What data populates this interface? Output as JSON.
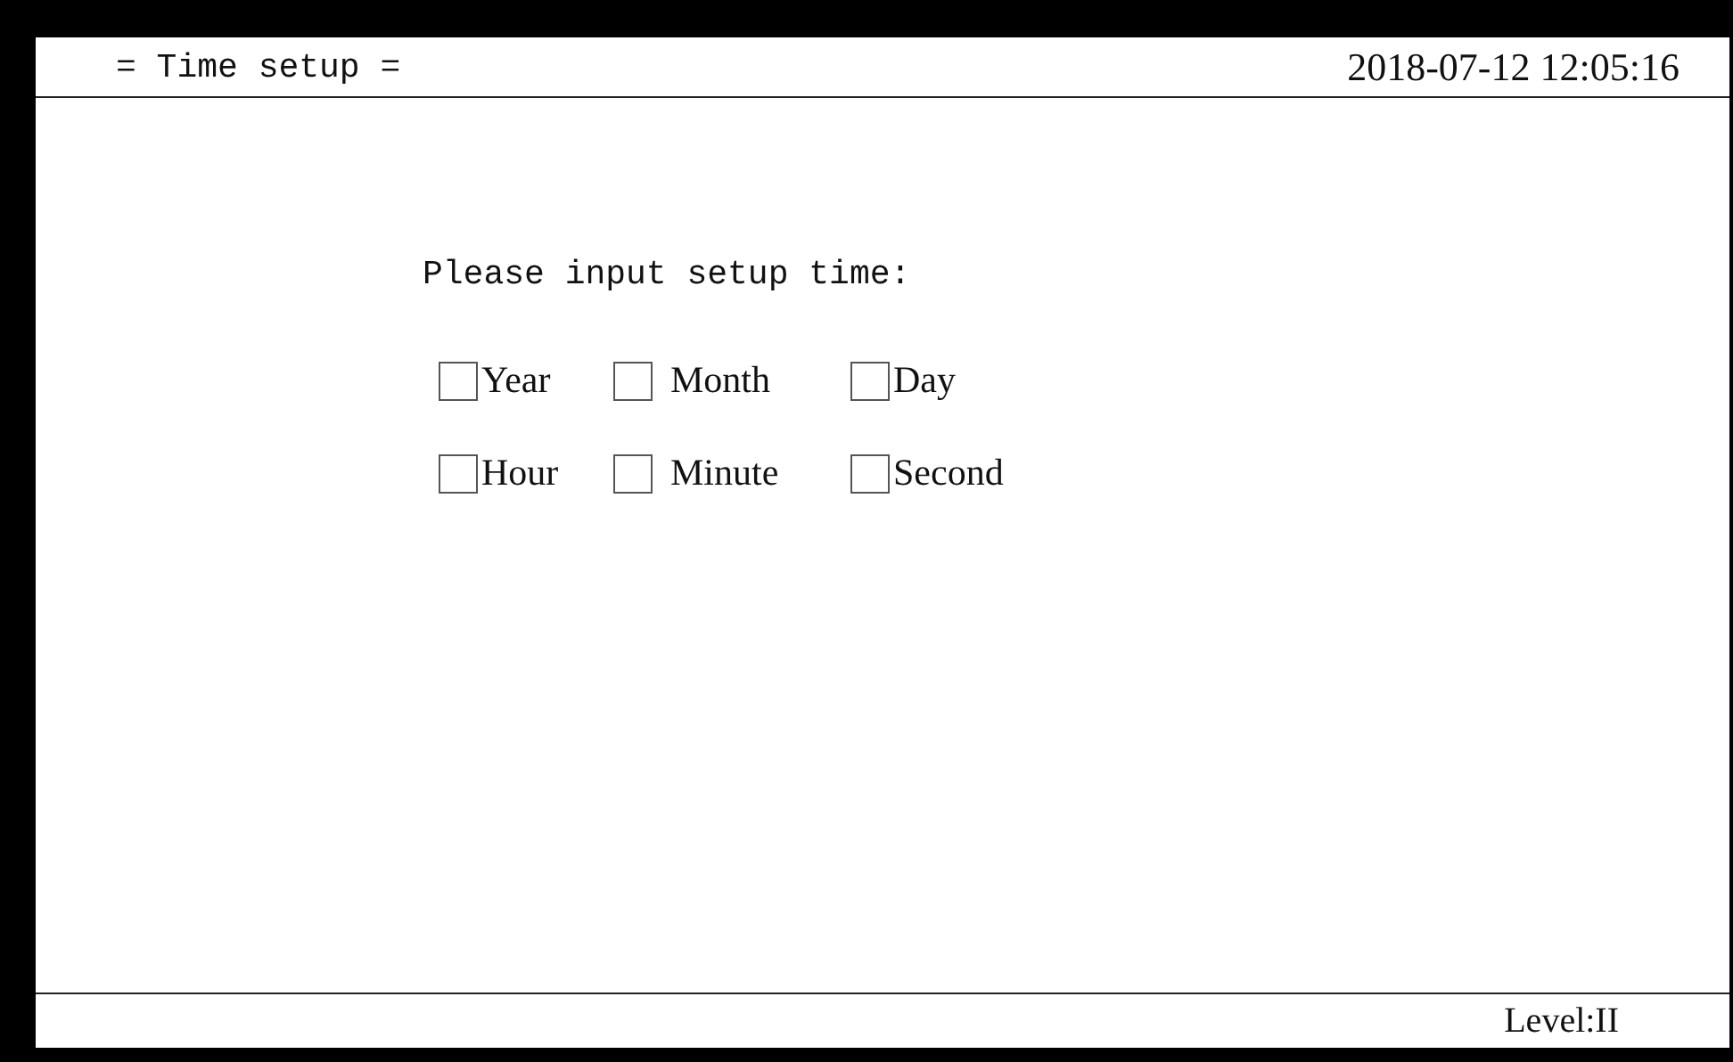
{
  "header": {
    "title": "= Time setup =",
    "datetime": "2018-07-12 12:05:16"
  },
  "prompt": "Please input setup time:",
  "fields": [
    {
      "label": "Year"
    },
    {
      "label": "Month"
    },
    {
      "label": "Day"
    },
    {
      "label": "Hour"
    },
    {
      "label": "Minute"
    },
    {
      "label": "Second"
    }
  ],
  "status_bar": {
    "level": "Level:II"
  }
}
